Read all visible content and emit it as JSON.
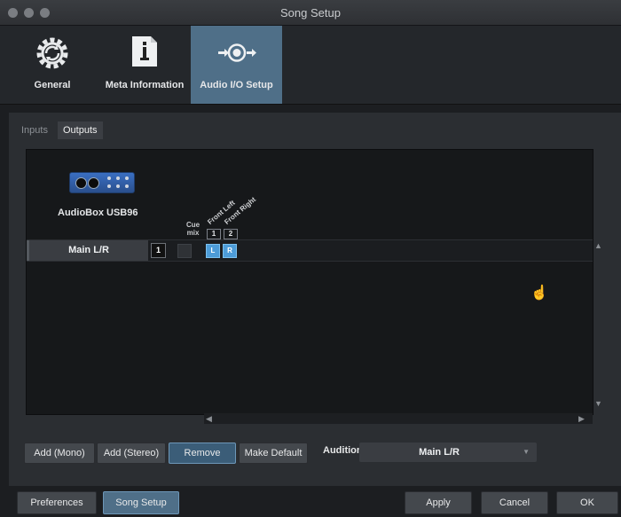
{
  "window": {
    "title": "Song Setup"
  },
  "toolbar": {
    "items": [
      {
        "label": "General",
        "icon": "gear-icon"
      },
      {
        "label": "Meta Information",
        "icon": "document-info-icon"
      },
      {
        "label": "Audio I/O Setup",
        "icon": "audio-io-icon",
        "active": true
      }
    ]
  },
  "tabs": [
    {
      "label": "Inputs",
      "active": false
    },
    {
      "label": "Outputs",
      "active": true
    }
  ],
  "device": {
    "name": "AudioBox USB96",
    "cue_label_line1": "Cue",
    "cue_label_line2": "mix",
    "channels": [
      {
        "number": "1",
        "name": "Front Left"
      },
      {
        "number": "2",
        "name": "Front Right"
      }
    ]
  },
  "outputs": [
    {
      "name": "Main L/R",
      "channel": "1",
      "assign_left": "L",
      "assign_right": "R"
    }
  ],
  "buttons": {
    "add_mono": "Add (Mono)",
    "add_stereo": "Add (Stereo)",
    "remove": "Remove",
    "make_default": "Make Default"
  },
  "audition": {
    "label": "Audition",
    "value": "Main L/R"
  },
  "footer": {
    "preferences": "Preferences",
    "song_setup": "Song Setup",
    "apply": "Apply",
    "cancel": "Cancel",
    "ok": "OK"
  },
  "colors": {
    "accent": "#4f6f88",
    "assign": "#4d9cd8"
  }
}
